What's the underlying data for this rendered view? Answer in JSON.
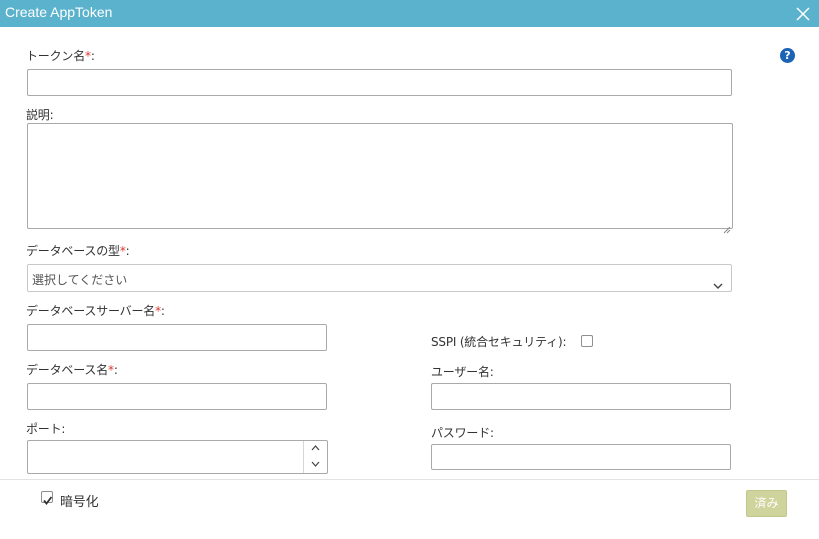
{
  "dialog": {
    "title": "Create AppToken",
    "help_symbol": "?"
  },
  "form": {
    "token_name": {
      "label": "トークン名",
      "required_mark": "*",
      "colon": ":",
      "value": ""
    },
    "description": {
      "label": "説明:",
      "value": ""
    },
    "database_type": {
      "label": "データベースの型",
      "required_mark": "*",
      "colon": ":",
      "selected": "選択してください"
    },
    "server_name": {
      "label": "データベースサーバー名",
      "required_mark": "*",
      "colon": ":",
      "value": ""
    },
    "sspi": {
      "label": "SSPI (統合セキュリティ):",
      "checked": false
    },
    "database_name": {
      "label": "データベース名",
      "required_mark": "*",
      "colon": ":",
      "value": ""
    },
    "username": {
      "label": "ユーザー名:",
      "value": ""
    },
    "port": {
      "label": "ポート:",
      "value": ""
    },
    "password": {
      "label": "パスワード:",
      "value": ""
    },
    "encryption": {
      "label": "暗号化",
      "checked": true
    }
  },
  "footer": {
    "save_label": "済み"
  },
  "colors": {
    "titlebar": "#5ab2cc",
    "required": "#e0362f",
    "save_button": "#cfd39c",
    "help_icon": "#1b63b5"
  }
}
